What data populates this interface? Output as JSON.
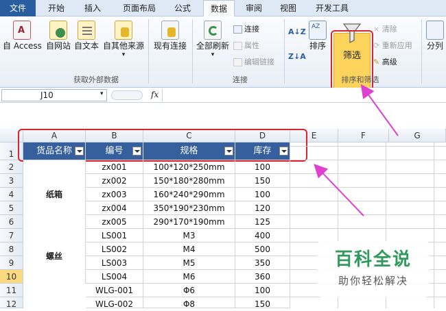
{
  "tabs": [
    "文件",
    "开始",
    "插入",
    "页面布局",
    "公式",
    "数据",
    "审阅",
    "视图",
    "开发工具"
  ],
  "ribbon": {
    "get_external": {
      "buttons": [
        "自 Access",
        "自网站",
        "自文本",
        "自其他来源",
        "现有连接"
      ],
      "group_label": "获取外部数据"
    },
    "connections": {
      "refresh_all": "全部刷新",
      "small": [
        "连接",
        "属性",
        "编辑链接"
      ],
      "group_label": "连接"
    },
    "sort_filter": {
      "sort": "排序",
      "filter": "筛选",
      "small": [
        "清除",
        "重新应用",
        "高级"
      ],
      "group_label": "排序和筛选"
    },
    "split": "分列"
  },
  "formula_bar": {
    "name_box": "J10",
    "fx": "fx"
  },
  "columns": [
    "A",
    "B",
    "C",
    "D",
    "E",
    "F",
    "G"
  ],
  "rows": [
    "1",
    "2",
    "3",
    "4",
    "5",
    "6",
    "7",
    "8",
    "9",
    "10",
    "11",
    "12"
  ],
  "header_row": [
    "货品名称",
    "编号",
    "规格",
    "库存"
  ],
  "groups": [
    {
      "name": "纸箱"
    },
    {
      "name": "螺丝"
    }
  ],
  "data_rows": [
    {
      "code": "zx001",
      "spec": "100*120*250mm",
      "stock": "100"
    },
    {
      "code": "zx002",
      "spec": "150*180*280mm",
      "stock": "150"
    },
    {
      "code": "zx003",
      "spec": "160*240*290mm",
      "stock": "100"
    },
    {
      "code": "zx004",
      "spec": "350*190*230mm",
      "stock": "120"
    },
    {
      "code": "zx005",
      "spec": "290*170*190mm",
      "stock": "125"
    },
    {
      "code": "LS001",
      "spec": "M3",
      "stock": "400"
    },
    {
      "code": "LS002",
      "spec": "M4",
      "stock": "500"
    },
    {
      "code": "LS003",
      "spec": "M5",
      "stock": "350"
    },
    {
      "code": "LS004",
      "spec": "M6",
      "stock": "360"
    },
    {
      "code": "WLG-001",
      "spec": "Φ6",
      "stock": "100"
    },
    {
      "code": "WLG-002",
      "spec": "Φ8",
      "stock": "150"
    }
  ],
  "watermark": {
    "title": "百科全说",
    "subtitle": "助你轻松解决"
  },
  "colors": {
    "header_fill": "#35609d",
    "filter_highlight": "#fcd45c",
    "annotation_red": "#d9232d",
    "arrow_magenta": "#e040d0"
  }
}
